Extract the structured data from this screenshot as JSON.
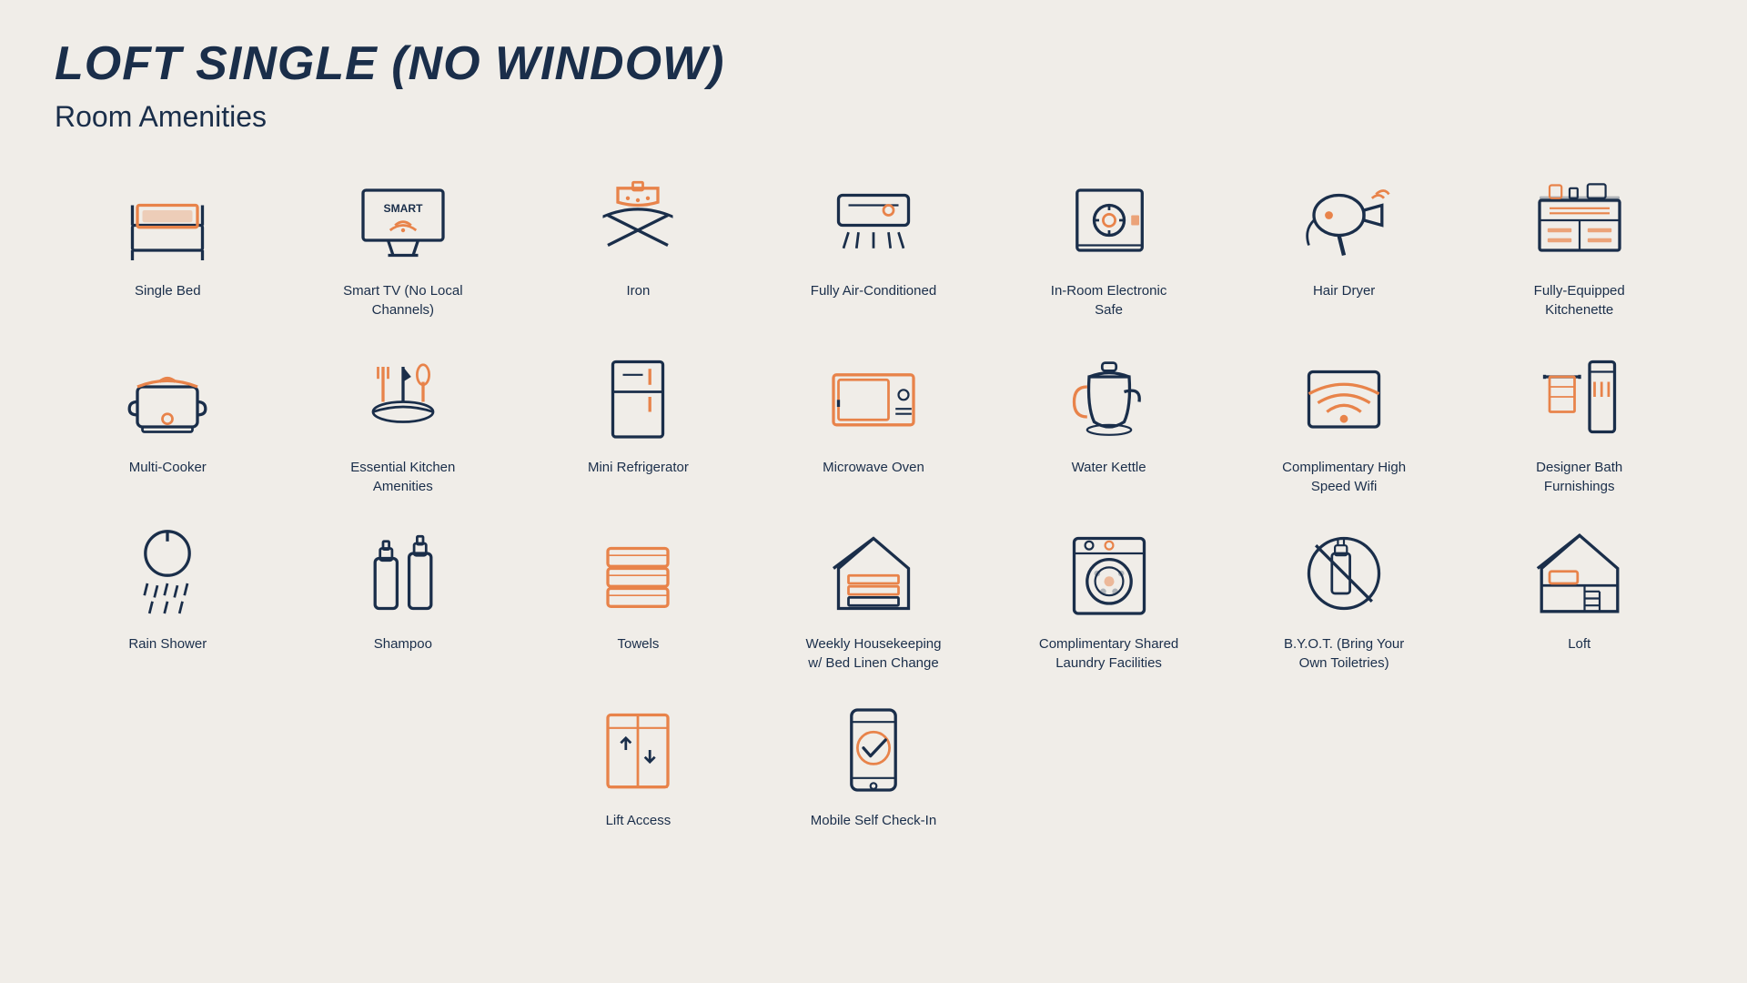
{
  "page": {
    "title": "LOFT SINGLE (NO WINDOW)",
    "subtitle": "Room Amenities"
  },
  "amenities": [
    {
      "id": "single-bed",
      "label": "Single Bed"
    },
    {
      "id": "smart-tv",
      "label": "Smart TV (No Local Channels)"
    },
    {
      "id": "iron",
      "label": "Iron"
    },
    {
      "id": "air-conditioned",
      "label": "Fully Air-Conditioned"
    },
    {
      "id": "electronic-safe",
      "label": "In-Room Electronic Safe"
    },
    {
      "id": "hair-dryer",
      "label": "Hair Dryer"
    },
    {
      "id": "kitchenette",
      "label": "Fully-Equipped Kitchenette"
    },
    {
      "id": "multi-cooker",
      "label": "Multi-Cooker"
    },
    {
      "id": "kitchen-amenities",
      "label": "Essential Kitchen Amenities"
    },
    {
      "id": "mini-refrigerator",
      "label": "Mini Refrigerator"
    },
    {
      "id": "microwave",
      "label": "Microwave Oven"
    },
    {
      "id": "water-kettle",
      "label": "Water Kettle"
    },
    {
      "id": "wifi",
      "label": "Complimentary High Speed Wifi"
    },
    {
      "id": "bath-furnishings",
      "label": "Designer Bath Furnishings"
    },
    {
      "id": "rain-shower",
      "label": "Rain Shower"
    },
    {
      "id": "shampoo",
      "label": "Shampoo"
    },
    {
      "id": "towels",
      "label": "Towels"
    },
    {
      "id": "housekeeping",
      "label": "Weekly Housekeeping w/ Bed Linen Change"
    },
    {
      "id": "laundry",
      "label": "Complimentary Shared Laundry Facilities"
    },
    {
      "id": "byot",
      "label": "B.Y.O.T. (Bring Your Own Toiletries)"
    },
    {
      "id": "loft",
      "label": "Loft"
    },
    {
      "id": "lift",
      "label": "Lift Access"
    },
    {
      "id": "mobile-checkin",
      "label": "Mobile Self Check-In"
    }
  ]
}
